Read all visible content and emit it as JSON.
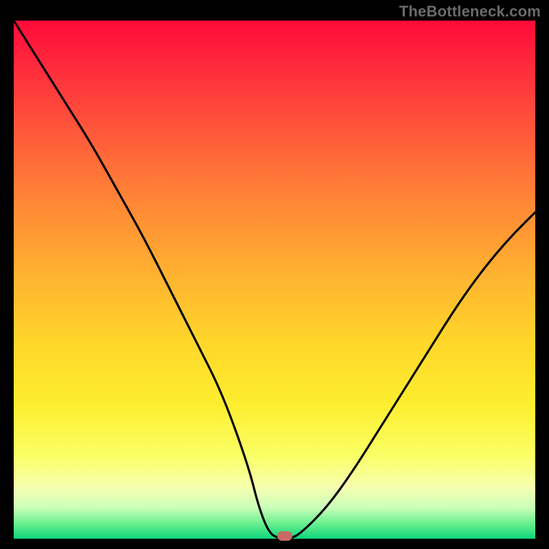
{
  "watermark": "TheBottleneck.com",
  "chart_data": {
    "type": "line",
    "title": "",
    "xlabel": "",
    "ylabel": "",
    "xlim": [
      0,
      100
    ],
    "ylim": [
      0,
      100
    ],
    "grid": false,
    "legend": false,
    "series": [
      {
        "name": "bottleneck-curve",
        "x": [
          0,
          5,
          10,
          15,
          20,
          25,
          30,
          35,
          40,
          45,
          47,
          49,
          51,
          53,
          55,
          60,
          65,
          70,
          75,
          80,
          85,
          90,
          95,
          100
        ],
        "y": [
          100,
          92,
          84,
          76,
          67,
          58,
          48,
          38,
          28,
          14,
          6,
          1,
          0,
          0,
          1,
          6,
          13,
          21,
          29,
          37,
          45,
          52,
          58,
          63
        ]
      }
    ],
    "marker": {
      "x": 52,
      "y": 0.5
    },
    "background_gradient": {
      "top": "#ff0a3a",
      "bottom": "#0ed47a"
    }
  }
}
